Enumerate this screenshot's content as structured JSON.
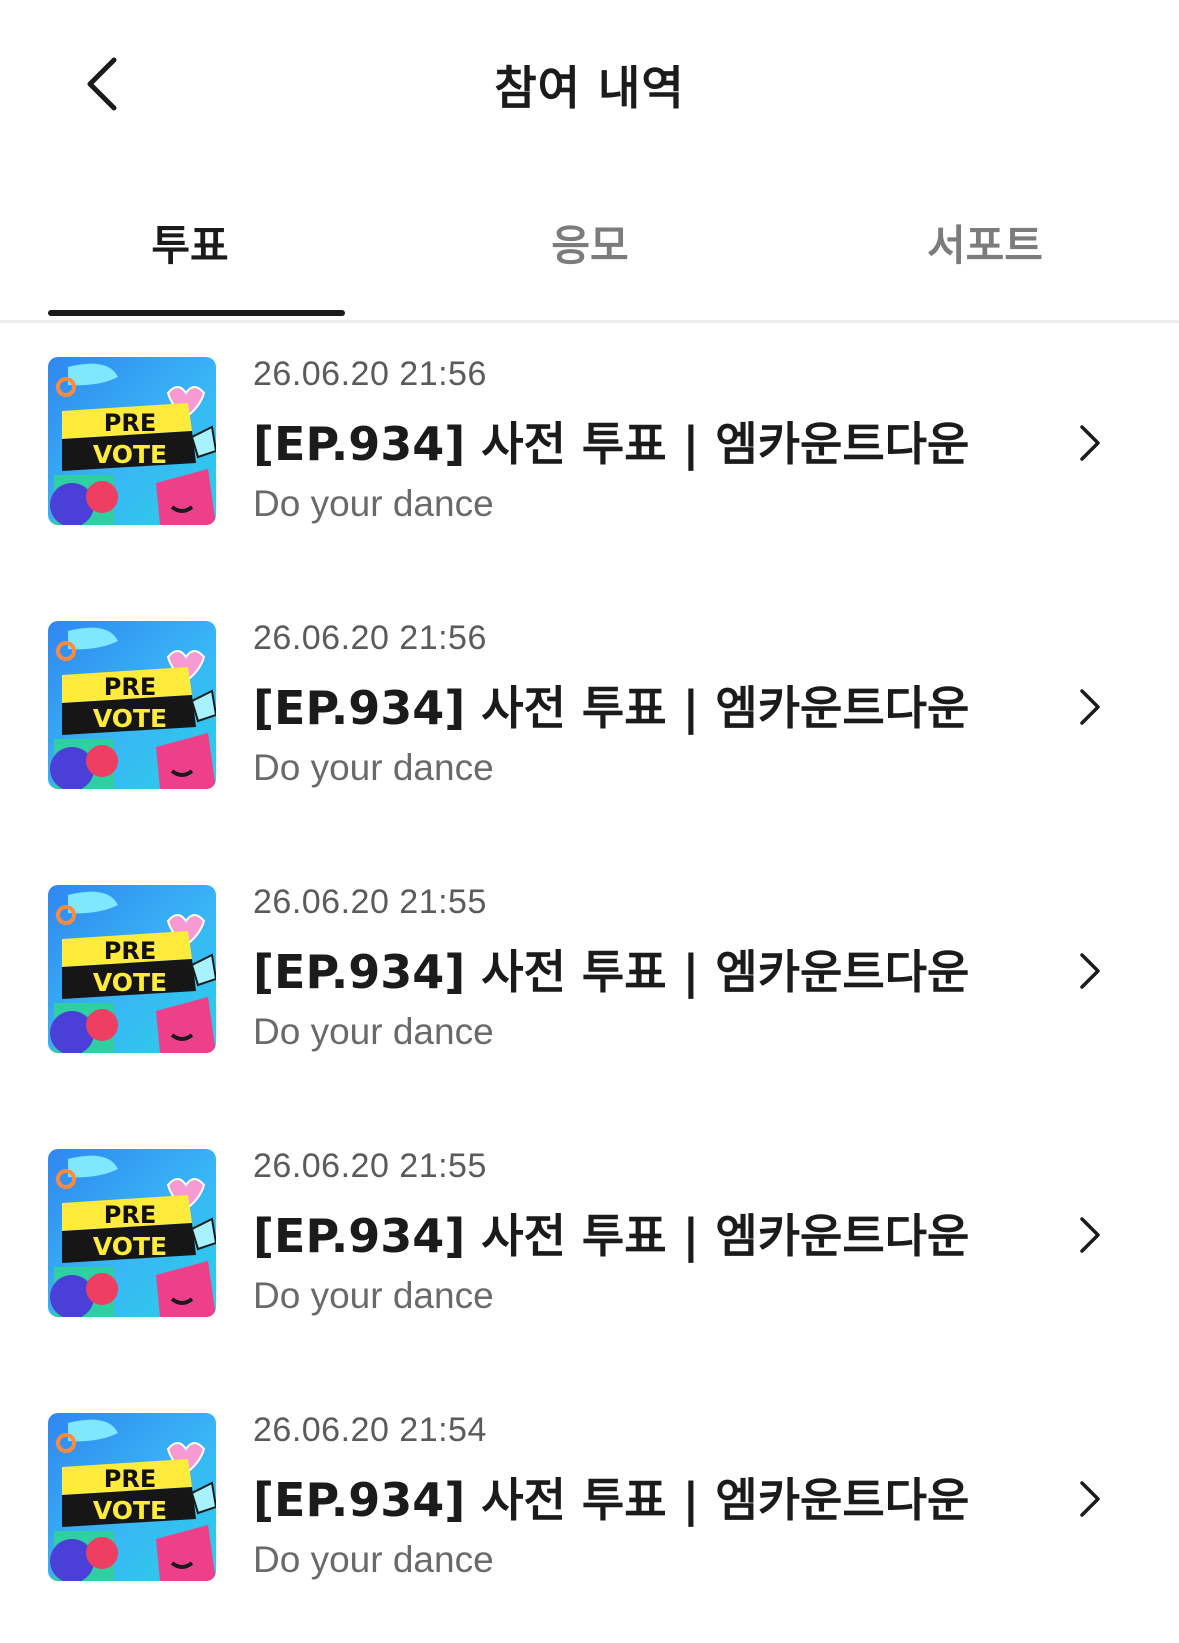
{
  "header": {
    "title": "참여 내역",
    "back_icon": "chevron-left-icon"
  },
  "tabs": [
    {
      "label": "투표",
      "active": true
    },
    {
      "label": "응모",
      "active": false
    },
    {
      "label": "서포트",
      "active": false
    }
  ],
  "thumbnail": {
    "line1": "PRE",
    "line2": "VOTE"
  },
  "items": [
    {
      "date": "26.06.20 21:56",
      "title": "[EP.934] 사전 투표 | 엠카운트다운",
      "subtitle": "Do your dance"
    },
    {
      "date": "26.06.20 21:56",
      "title": "[EP.934] 사전 투표 | 엠카운트다운",
      "subtitle": "Do your dance"
    },
    {
      "date": "26.06.20 21:55",
      "title": "[EP.934] 사전 투표 | 엠카운트다운",
      "subtitle": "Do your dance"
    },
    {
      "date": "26.06.20 21:55",
      "title": "[EP.934] 사전 투표 | 엠카운트다운",
      "subtitle": "Do your dance"
    },
    {
      "date": "26.06.20 21:54",
      "title": "[EP.934] 사전 투표 | 엠카운트다운",
      "subtitle": "Do your dance"
    }
  ],
  "colors": {
    "text_primary": "#1b1b1b",
    "text_secondary": "#6a6a6a",
    "tab_inactive": "#7c7c7c",
    "divider": "#ececec"
  }
}
